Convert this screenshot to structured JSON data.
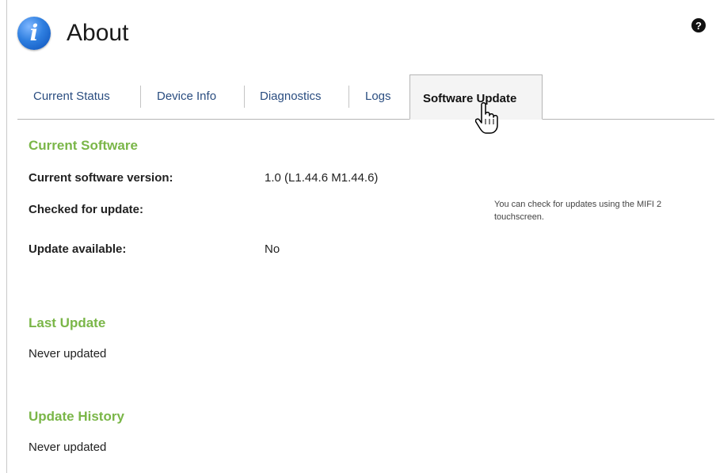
{
  "page": {
    "title": "About",
    "help_icon": "question-circle-icon",
    "title_icon": "info-circle-icon"
  },
  "tabs": [
    {
      "label": "Current Status",
      "active": false
    },
    {
      "label": "Device Info",
      "active": false
    },
    {
      "label": "Diagnostics",
      "active": false
    },
    {
      "label": "Logs",
      "active": false
    },
    {
      "label": "Software Update",
      "active": true
    }
  ],
  "current_software": {
    "title": "Current Software",
    "version_label": "Current software version:",
    "version_value": "1.0 (L1.44.6 M1.44.6)",
    "checked_label": "Checked for update:",
    "checked_value": "",
    "available_label": "Update available:",
    "available_value": "No",
    "note": "You can check for updates using the MIFI 2 touchscreen."
  },
  "last_update": {
    "title": "Last Update",
    "text": "Never updated"
  },
  "update_history": {
    "title": "Update History",
    "text": "Never updated"
  },
  "colors": {
    "section_title": "#7ab648",
    "tab_link": "#2a4d80",
    "icon_blue": "#2f7fe0"
  }
}
